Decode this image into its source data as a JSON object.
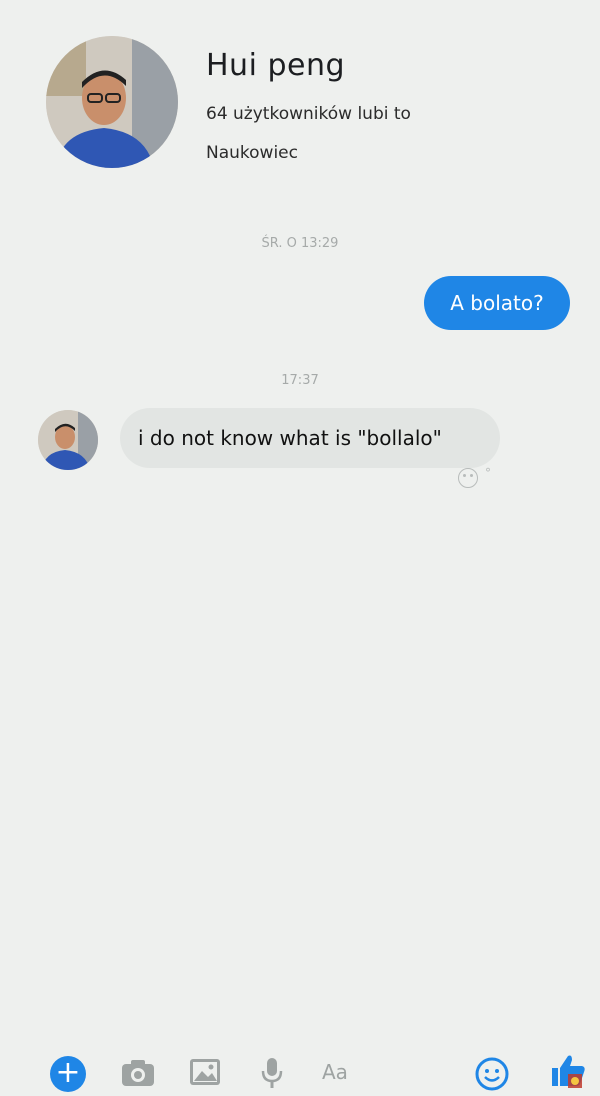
{
  "profile": {
    "name": "Hui peng",
    "likes": "64 użytkowników lubi to",
    "occupation": "Naukowiec"
  },
  "conversation": {
    "timestamp_1": "ŚR. O 13:29",
    "outgoing_message": "A bolato?",
    "timestamp_2": "17:37",
    "incoming_message": "i do not know what is \"bollalo\""
  },
  "composer": {
    "text_placeholder": "Aa",
    "icons": [
      "plus-icon",
      "camera-icon",
      "image-icon",
      "microphone-icon",
      "emoji-icon",
      "thumbs-up-icon"
    ]
  },
  "colors": {
    "accent": "#1f86e6",
    "background": "#eef0ee",
    "incoming_bubble": "#e2e5e3"
  }
}
